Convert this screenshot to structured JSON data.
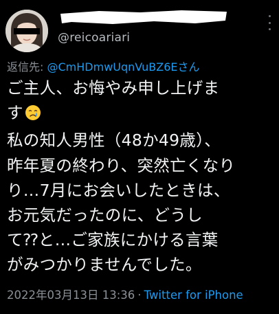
{
  "tweet": {
    "handle": "@reicoariari",
    "reply_prefix": "返信先:",
    "reply_mention": "@CmHDmwUqnVuBZ6Eさん",
    "lines": [
      "ご主人、お悔やみ申し上げま",
      "す",
      "私の知人男性（48か49歳）、",
      "昨年夏の終わり、突然亡くなり",
      "り…7月にお会いしたときは、",
      "お元気だったのに、どうし",
      "て⁇と…ご家族にかける言葉",
      "がみつかりませんでした。"
    ],
    "emoji": "crying-face",
    "timestamp": "2022年03月13日 13:36",
    "separator": "·",
    "source": "Twitter for iPhone"
  },
  "colors": {
    "background": "#000000",
    "text": "#f2f3f4",
    "secondary": "#8b9197",
    "link": "#1d9bf0"
  }
}
